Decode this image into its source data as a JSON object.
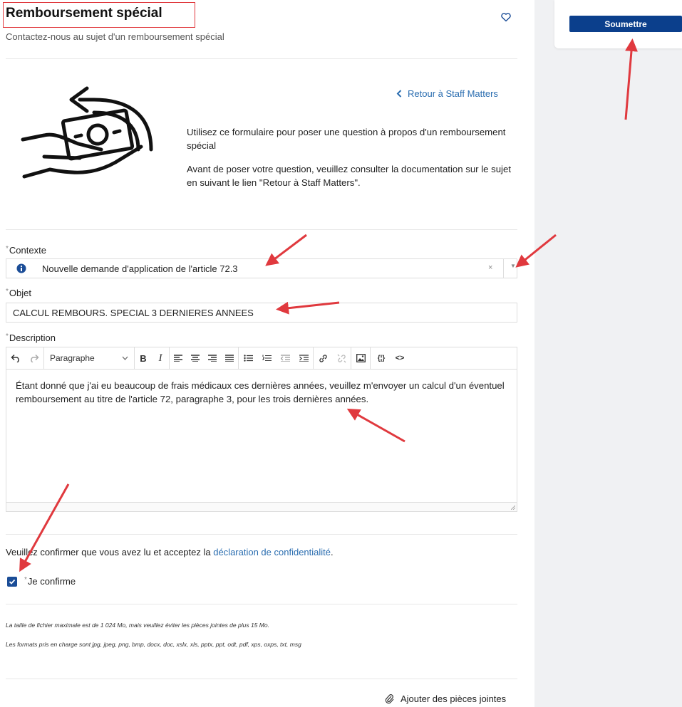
{
  "header": {
    "title": "Remboursement spécial",
    "subtitle": "Contactez-nous au sujet d'un remboursement spécial"
  },
  "sidebar": {
    "submit_label": "Soumettre"
  },
  "intro": {
    "back_link": "Retour à Staff Matters",
    "paragraph1": "Utilisez ce formulaire pour poser une question à propos d'un remboursement spécial",
    "paragraph2": "Avant de poser votre question, veuillez consulter la documentation sur le sujet en suivant le lien \"Retour à Staff Matters\"."
  },
  "form": {
    "context": {
      "label": "Contexte",
      "value": "Nouvelle demande d'application de l'article 72.3",
      "clear": "×",
      "arrow": "▼"
    },
    "subject": {
      "label": "Objet",
      "value": "CALCUL REMBOURS. SPECIAL 3 DERNIERES ANNEES"
    },
    "description": {
      "label": "Description",
      "paragraph_style": "Paragraphe",
      "text": "Étant donné que j'ai eu beaucoup de frais médicaux ces dernières années, veuillez m'envoyer un calcul d'un éventuel remboursement au titre de l'article 72, paragraphe 3, pour les trois dernières années."
    },
    "required_mark": "*",
    "privacy": {
      "prefix": "Veuillez confirmer que vous avez lu et acceptez la ",
      "link": "déclaration de confidentialité",
      "suffix": "."
    },
    "confirm_label": "Je confirme",
    "confirm_checked": true
  },
  "attachments": {
    "note1": "La taille de fichier maximale est de 1 024 Mo, mais veuillez éviter les pièces jointes de plus 15 Mo.",
    "note2": "Les formats pris en charge sont jpg, jpeg, png, bmp,  docx, doc, xslx, xls, pptx, ppt, odt, pdf, xps, oxps, txt, msg",
    "add_label": "Ajouter des pièces jointes"
  },
  "colors": {
    "primary": "#0b3f8c",
    "link": "#2a6db0",
    "annotation_red": "#e0393e"
  }
}
